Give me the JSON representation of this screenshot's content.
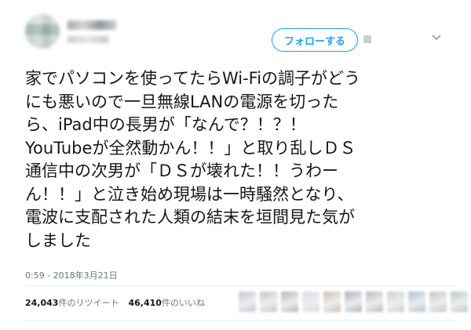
{
  "tweet": {
    "follow_label": "フォローする",
    "text_lines": [
      "家でパソコンを使ってたらWi-Fiの調子がどう",
      "にも悪いので一旦無線LANの電源を切った",
      "ら、iPad中の長男が「なんで？！？！",
      "YouTubeが全然動かん！！」と取り乱しＤＳ",
      "通信中の次男が「ＤＳが壊れた！！うわー",
      "ん！！」と泣き始め現場は一時騒然となり、",
      "電波に支配された人類の結末を垣間見た気が",
      "しました"
    ],
    "timestamp": "0:59 - 2018年3月21日",
    "retweets_num": "24,043",
    "retweets_label": "件のリツイート",
    "likes_num": "46,410",
    "likes_label": "件のいいね"
  },
  "icons": {
    "chevron": "chevron-down-icon"
  },
  "colors": {
    "accent": "#1da1f2",
    "meta_text": "#657786",
    "divider": "#e6ecf0"
  },
  "liker_colors": [
    "#b6bcc4",
    "#c8b7b8",
    "#a9a3b0",
    "#d2d6d9",
    "#c6b39c",
    "#9aa3ad",
    "#b9a7a9",
    "#c9c4bd",
    "#a3b4c1",
    "#c7b6b1",
    "#b3bdb6",
    "#e0b6a8"
  ]
}
